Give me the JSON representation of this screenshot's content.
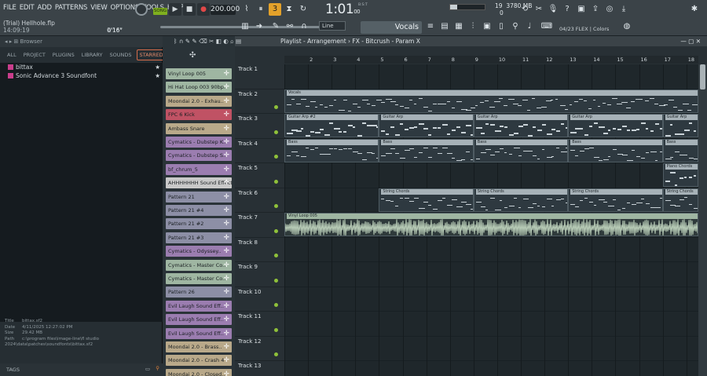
{
  "menu": [
    "FILE",
    "EDIT",
    "ADD",
    "PATTERNS",
    "VIEW",
    "OPTIONS",
    "TOOLS",
    "HELP"
  ],
  "project": {
    "title": "(Trial) Hellhole.flp",
    "time": "14:09:19",
    "position": "0'16\""
  },
  "transport": {
    "mode": "SONG",
    "tempo": "200.000",
    "time": "1:01",
    "time_sub": "00",
    "bst": "B:S:T"
  },
  "monitor": {
    "cpu_percent": 20,
    "cpu_value": "19",
    "ram": "3780 MB",
    "polyphony": "0"
  },
  "toolbar2": {
    "snap": "Line",
    "pattern": "Vocals",
    "hint": "04/23  FLEX | Colors"
  },
  "browser": {
    "title": "Browser",
    "tabs": [
      "ALL",
      "PROJECT",
      "PLUGINS",
      "LIBRARY",
      "SOUNDS",
      "STARRED"
    ],
    "active_tab": "STARRED",
    "items": [
      {
        "label": "bittax",
        "color": "#c93e8c",
        "starred": true
      },
      {
        "label": "Sonic Advance 3 Soundfont",
        "color": "#c93e8c",
        "starred": true
      }
    ],
    "info": [
      {
        "k": "Title",
        "v": "bittax.sf2"
      },
      {
        "k": "Date",
        "v": "4/11/2025 12:27:02 PM"
      },
      {
        "k": "Size",
        "v": "29.42 MB"
      },
      {
        "k": "Path",
        "v": "c:\\program files\\image-line\\fl studio 2024\\data\\patches\\soundfonts\\bittax.sf2"
      }
    ],
    "tags": "TAGS"
  },
  "patterns": [
    {
      "label": "Vinyl Loop 005",
      "color": "#9fb6a2"
    },
    {
      "label": "Hi Hat Loop 003 90bp..",
      "color": "#9fb6a2"
    },
    {
      "label": "Moondai 2.0 - Exhau..",
      "color": "#b9a98a"
    },
    {
      "label": "FPC 6 Kick",
      "color": "#c05264"
    },
    {
      "label": "Ambass Snare",
      "color": "#b9a98a"
    },
    {
      "label": "Cymatics - Dubstep K..",
      "color": "#9b7db0"
    },
    {
      "label": "Cymatics - Dubstep S..",
      "color": "#9b7db0"
    },
    {
      "label": "bf_chrum_5",
      "color": "#9b7db0"
    },
    {
      "label": "AHHHHHHH Sound Effect",
      "color": "#c9c9c9"
    },
    {
      "label": "Pattern 21",
      "color": "#8d8fa6"
    },
    {
      "label": "Pattern 21 #4",
      "color": "#8d8fa6"
    },
    {
      "label": "Pattern 21 #2",
      "color": "#8d8fa6"
    },
    {
      "label": "Pattern 21 #3",
      "color": "#8d8fa6"
    },
    {
      "label": "Cymatics - Odyssey..",
      "color": "#9b7db0"
    },
    {
      "label": "Cymatics - Master Co..",
      "color": "#9fb6a2"
    },
    {
      "label": "Cymatics - Master Co..",
      "color": "#9fb6a2"
    },
    {
      "label": "Pattern 26",
      "color": "#8d8fa6"
    },
    {
      "label": "Evil Laugh Sound Eff..",
      "color": "#9b7db0"
    },
    {
      "label": "Evil Laugh Sound Eff..",
      "color": "#9b7db0"
    },
    {
      "label": "Evil Laugh Sound Eff..",
      "color": "#9b7db0"
    },
    {
      "label": "Moondai 2.0 - Brass..",
      "color": "#b9a98a"
    },
    {
      "label": "Moondai 2.0 - Crash 4",
      "color": "#b9a98a"
    },
    {
      "label": "Moondai 2.0 - Closed..",
      "color": "#b9a98a"
    }
  ],
  "playlist": {
    "title": "Playlist - Arrangement › FX - Bitcrush - Param X",
    "bars": [
      "2",
      "3",
      "4",
      "5",
      "6",
      "7",
      "8",
      "9",
      "10",
      "11",
      "12",
      "13",
      "14",
      "15",
      "16",
      "17",
      "18"
    ],
    "tracks": [
      "Track 1",
      "Track 2",
      "Track 3",
      "Track 4",
      "Track 5",
      "Track 6",
      "Track 7",
      "Track 8",
      "Track 9",
      "Track 10",
      "Track 11",
      "Track 12",
      "Track 13"
    ],
    "clips": [
      {
        "track": 2,
        "start": 1,
        "len": 17.5,
        "label": "Vocals"
      },
      {
        "track": 3,
        "start": 1,
        "len": 4,
        "label": "Guitar Arp #2"
      },
      {
        "track": 3,
        "start": 5,
        "len": 4,
        "label": "Guitar Arp"
      },
      {
        "track": 3,
        "start": 9,
        "len": 4,
        "label": "Guitar Arp"
      },
      {
        "track": 3,
        "start": 13,
        "len": 4,
        "label": "Guitar Arp"
      },
      {
        "track": 3,
        "start": 17,
        "len": 1.5,
        "label": "Guitar Arp"
      },
      {
        "track": 4,
        "start": 1,
        "len": 4,
        "label": "Bass"
      },
      {
        "track": 4,
        "start": 5,
        "len": 4,
        "label": "Bass"
      },
      {
        "track": 4,
        "start": 9,
        "len": 4,
        "label": "Bass"
      },
      {
        "track": 4,
        "start": 13,
        "len": 4,
        "label": "Bass"
      },
      {
        "track": 4,
        "start": 17,
        "len": 1.5,
        "label": "Bass"
      },
      {
        "track": 5,
        "start": 17,
        "len": 1.5,
        "label": "Piano Chords"
      },
      {
        "track": 6,
        "start": 5,
        "len": 4,
        "label": "String Chords"
      },
      {
        "track": 6,
        "start": 9,
        "len": 4,
        "label": "String Chords"
      },
      {
        "track": 6,
        "start": 13,
        "len": 4,
        "label": "String Chords"
      },
      {
        "track": 6,
        "start": 17,
        "len": 1.5,
        "label": "String Chords"
      },
      {
        "track": 7,
        "start": 1,
        "len": 17.5,
        "label": "Vinyl Loop 005",
        "audio": true
      }
    ]
  }
}
